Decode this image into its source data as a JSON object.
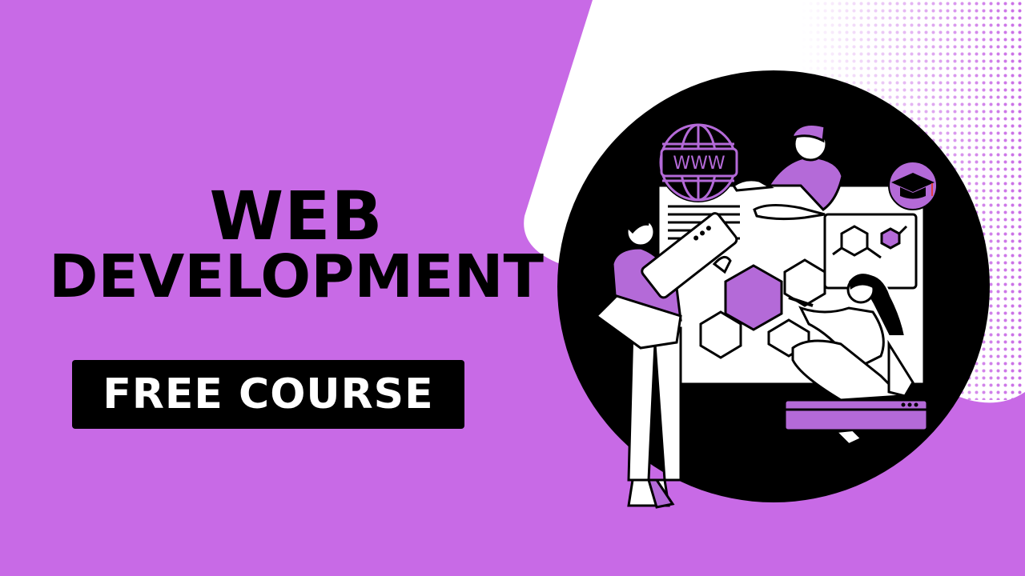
{
  "title": {
    "line1": "WEB",
    "line2": "DEVELOPMENT"
  },
  "badge": {
    "label": "FREE COURSE"
  },
  "illustration": {
    "globe_label": "WWW",
    "icons": [
      "globe-icon",
      "graduation-cap-icon",
      "molecule-icon",
      "hexagon-icon"
    ]
  },
  "colors": {
    "background": "#c86ae6",
    "accent": "#b46ad8",
    "dark": "#000000",
    "light": "#ffffff"
  }
}
